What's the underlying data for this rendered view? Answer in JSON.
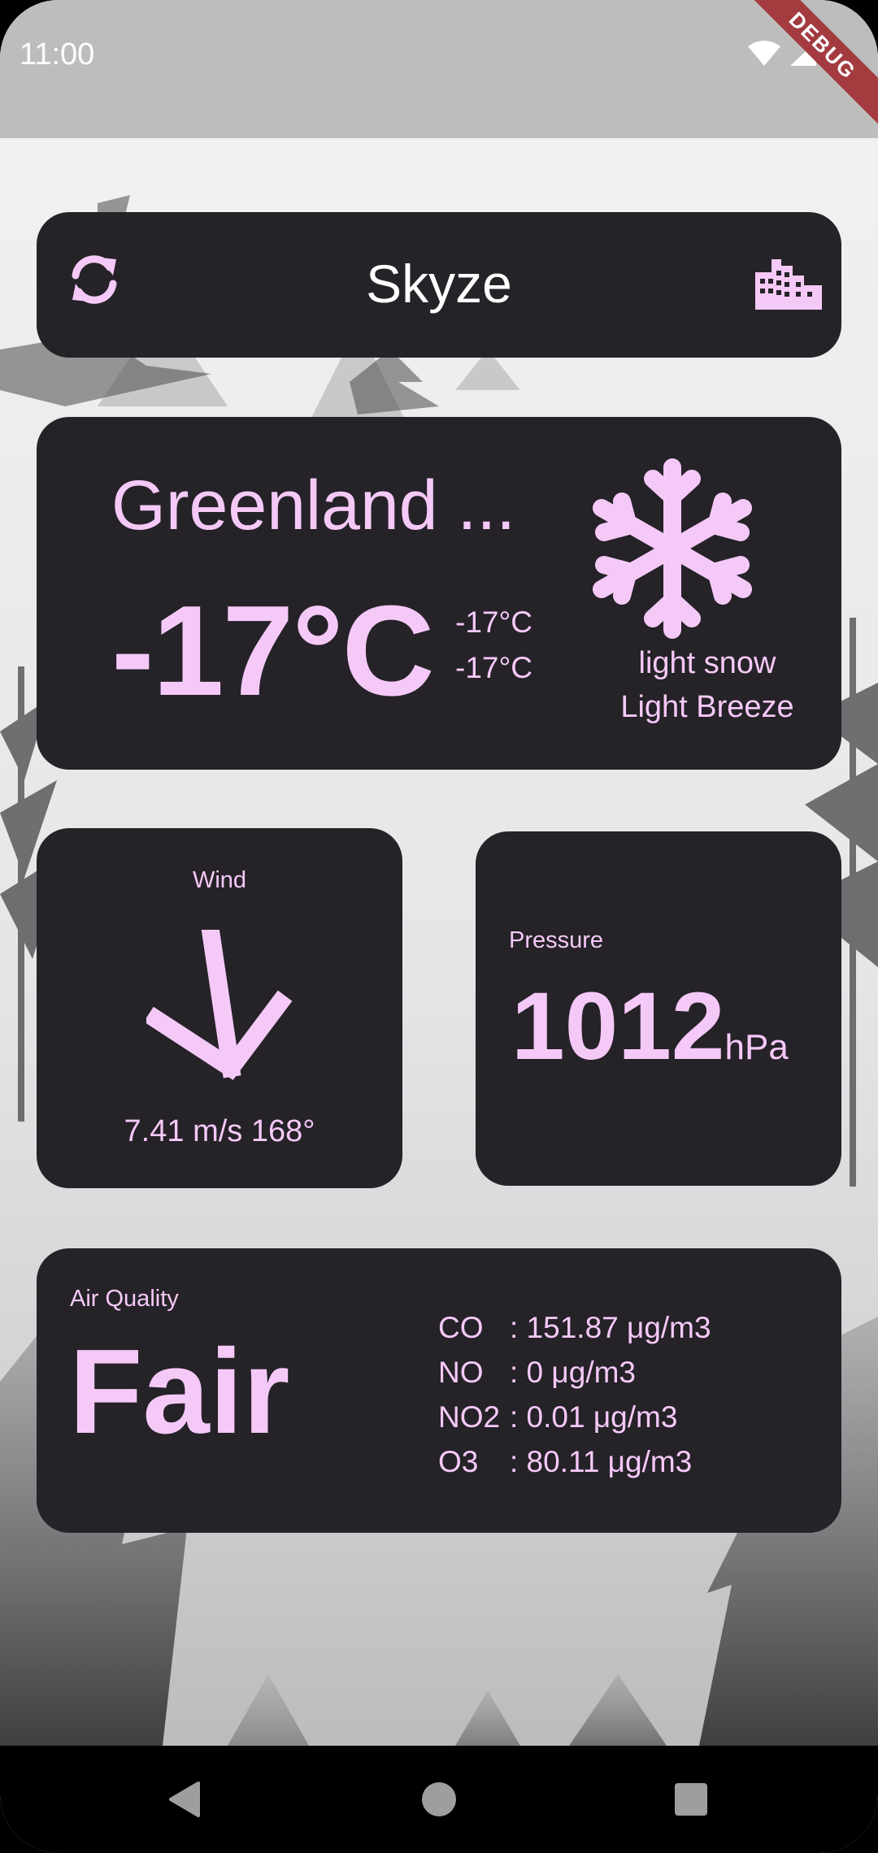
{
  "status_bar": {
    "time": "11:00",
    "debug_label": "DEBUG"
  },
  "app": {
    "title": "Skyze",
    "refresh_icon": "refresh-icon",
    "city_icon": "city-icon"
  },
  "weather": {
    "city": "Greenland ...",
    "temp": "-17°C",
    "temp_min": "-17°C",
    "temp_max": "-17°C",
    "condition": "light snow",
    "wind_desc": "Light Breeze",
    "icon": "snowflake-icon"
  },
  "wind": {
    "label": "Wind",
    "value": "7.41 m/s 168°",
    "direction_deg": 168
  },
  "pressure": {
    "label": "Pressure",
    "value": "1012",
    "unit": "hPa"
  },
  "air_quality": {
    "label": "Air Quality",
    "index": "Fair",
    "pollutants": [
      {
        "name": "CO",
        "value": ": 151.87 μg/m3"
      },
      {
        "name": "NO",
        "value": ": 0 μg/m3"
      },
      {
        "name": "NO2",
        "value": ": 0.01 μg/m3"
      },
      {
        "name": "O3",
        "value": ": 80.11 μg/m3"
      }
    ]
  },
  "colors": {
    "card": "#252228",
    "accent": "#f5c9f7",
    "status_bar": "#bdbdbd"
  }
}
